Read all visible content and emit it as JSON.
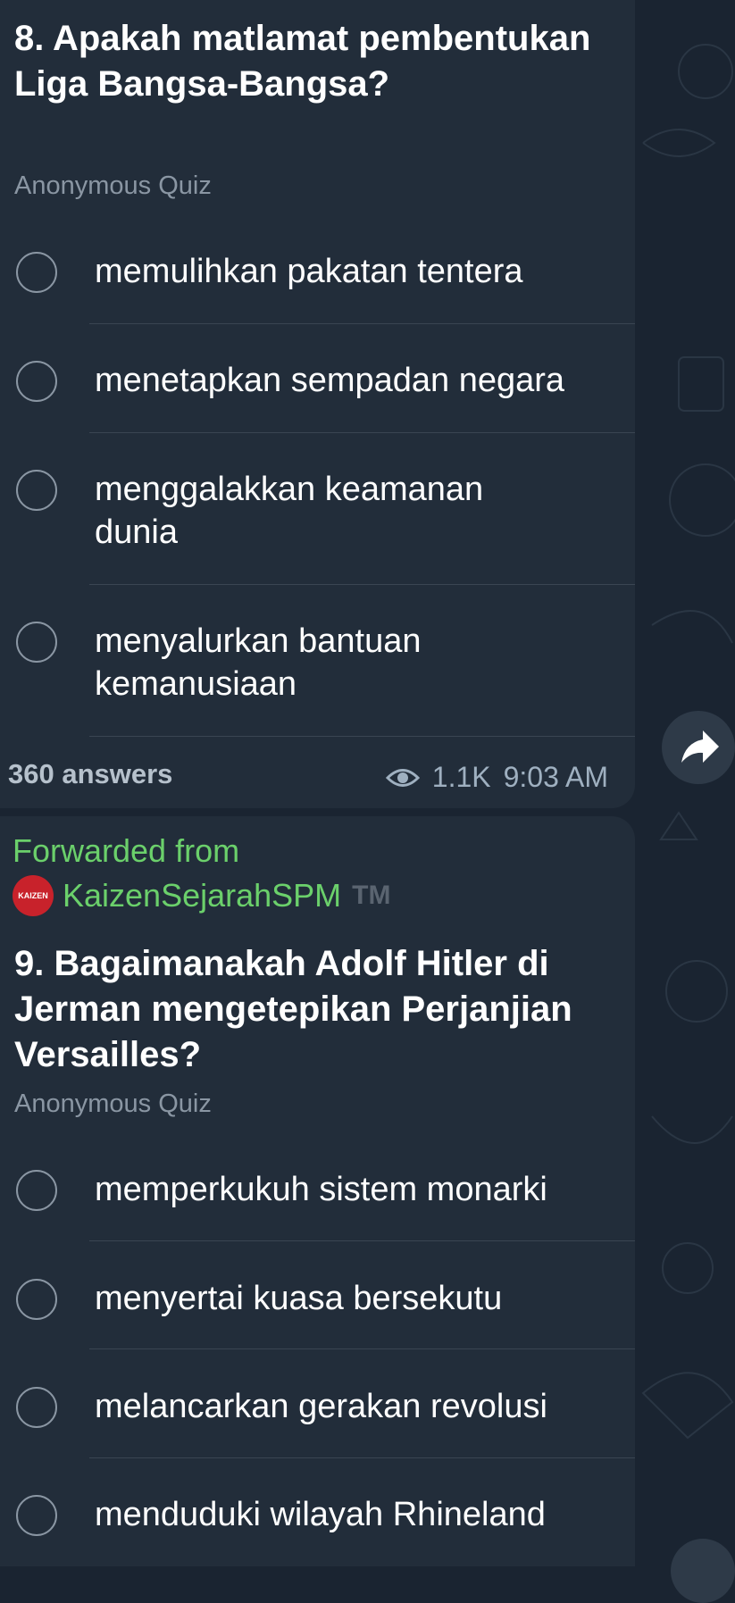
{
  "quiz1": {
    "question": "8. Apakah matlamat pembentukan Liga Bangsa-Bangsa?",
    "type": "Anonymous Quiz",
    "options": [
      "memulihkan pakatan tentera",
      "menetapkan sempadan negara",
      "menggalakkan keamanan dunia",
      "menyalurkan bantuan kemanusiaan"
    ],
    "answers": "360 answers",
    "views": "1.1K",
    "time": "9:03 AM"
  },
  "forward": {
    "label": "Forwarded from",
    "channel": "KaizenSejarahSPM",
    "tm": "TM",
    "avatar_text": "KAIZEN"
  },
  "quiz2": {
    "question": "9. Bagaimanakah Adolf Hitler di Jerman mengetepikan Perjanjian Versailles?",
    "type": "Anonymous Quiz",
    "options": [
      "memperkukuh sistem monarki",
      "menyertai kuasa bersekutu",
      "melancarkan gerakan revolusi",
      "menduduki wilayah Rhineland"
    ]
  },
  "colors": {
    "background": "#1a2431",
    "bubble": "#222d3a",
    "forward_green": "#6bd06b",
    "secondary_text": "#8a96a3"
  },
  "icons": {
    "views": "eye-icon",
    "share": "share-arrow-icon",
    "radio": "radio-circle-icon"
  }
}
